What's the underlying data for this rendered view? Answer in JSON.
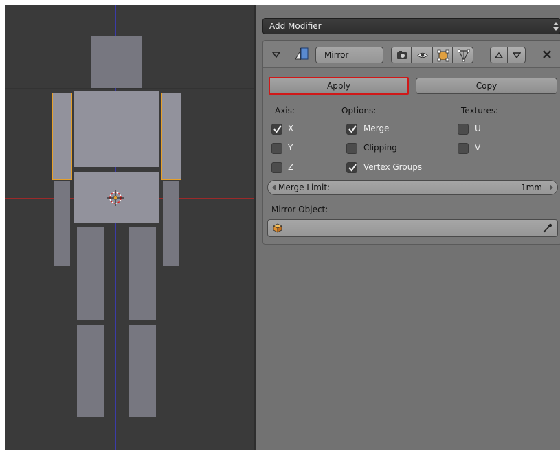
{
  "panel": {
    "add_modifier_label": "Add Modifier",
    "modifier": {
      "name": "Mirror",
      "apply_label": "Apply",
      "copy_label": "Copy",
      "axis_heading": "Axis:",
      "options_heading": "Options:",
      "textures_heading": "Textures:",
      "axis": [
        {
          "label": "X",
          "checked": true
        },
        {
          "label": "Y",
          "checked": false
        },
        {
          "label": "Z",
          "checked": false
        }
      ],
      "options": [
        {
          "label": "Merge",
          "checked": true
        },
        {
          "label": "Clipping",
          "checked": false
        },
        {
          "label": "Vertex Groups",
          "checked": true
        }
      ],
      "textures": [
        {
          "label": "U",
          "checked": false
        },
        {
          "label": "V",
          "checked": false
        }
      ],
      "merge_limit_label": "Merge Limit:",
      "merge_limit_value": "1mm",
      "mirror_object_label": "Mirror Object:",
      "mirror_object_value": ""
    }
  },
  "colors": {
    "viewport_bg": "#3a3a3a",
    "panel_bg": "#727272",
    "selection_outline": "#e6a02a",
    "apply_highlight": "#d01818",
    "axis_x": "#9b2a2a",
    "axis_y": "#3b3ba8"
  },
  "icons": {
    "collapse": "triangle-down-icon",
    "modifier_type": "mirror-modifier-icon",
    "render": "camera-icon",
    "viewport": "eye-icon",
    "editmode": "editmode-icon",
    "cage": "vertex-triangle-icon",
    "move_up": "arrow-up-icon",
    "move_down": "arrow-down-icon",
    "remove": "close-icon",
    "object": "cube-icon",
    "eyedropper": "eyedropper-icon"
  }
}
